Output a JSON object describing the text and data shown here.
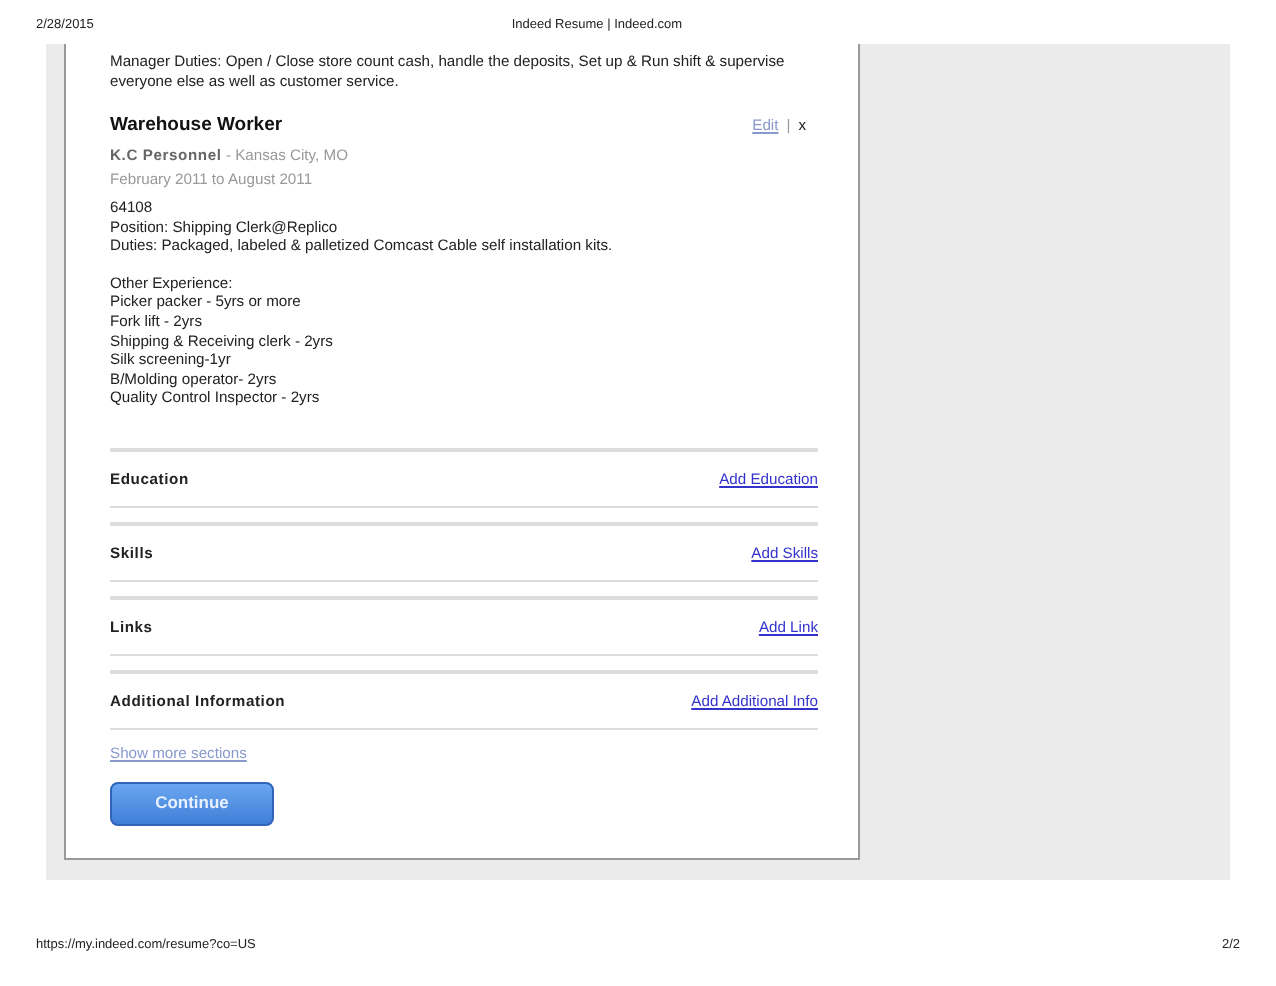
{
  "print_header": {
    "date": "2/28/2015",
    "title": "Indeed Resume | Indeed.com"
  },
  "previous_description": "Manager Duties: Open / Close store count cash, handle the deposits, Set up & Run shift & supervise everyone else as well as customer service.",
  "job": {
    "title": "Warehouse Worker",
    "edit_link": "Edit",
    "separator": "|",
    "delete": "x",
    "company": "K.C Personnel",
    "location": "- Kansas City, MO",
    "dates": "February 2011 to August 2011",
    "description": [
      "64108",
      "Position: Shipping Clerk@Replico",
      "Duties: Packaged, labeled & palletized Comcast Cable self installation kits."
    ],
    "other_experience": [
      "Other Experience:",
      "Picker packer - 5yrs or more",
      "Fork lift - 2yrs",
      "Shipping & Receiving clerk - 2yrs",
      "Silk screening-1yr",
      "B/Molding operator- 2yrs",
      "Quality Control Inspector - 2yrs"
    ]
  },
  "sections": [
    {
      "title": "Education",
      "link": "Add Education"
    },
    {
      "title": "Skills",
      "link": "Add Skills"
    },
    {
      "title": "Links",
      "link": "Add Link"
    },
    {
      "title": "Additional Information",
      "link": "Add Additional Info"
    }
  ],
  "show_more": "Show more sections",
  "continue_button": "Continue",
  "print_footer": {
    "url": "https://my.indeed.com/resume?co=US",
    "page": "2/2"
  }
}
